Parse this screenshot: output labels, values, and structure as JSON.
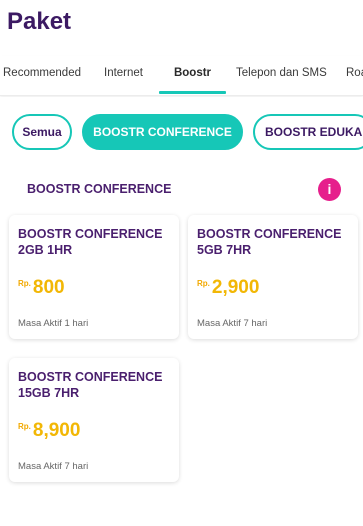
{
  "header": {
    "title": "Paket"
  },
  "tabs": [
    {
      "label": "Recommended"
    },
    {
      "label": "Internet"
    },
    {
      "label": "Boostr"
    },
    {
      "label": "Telepon dan SMS"
    },
    {
      "label": "Roa"
    }
  ],
  "active_tab": "Boostr",
  "filters": [
    {
      "label": "Semua"
    },
    {
      "label": "BOOSTR CONFERENCE"
    },
    {
      "label": "BOOSTR EDUKA"
    }
  ],
  "active_filter": "BOOSTR CONFERENCE",
  "section": {
    "title": "BOOSTR CONFERENCE",
    "info_icon": "i"
  },
  "cards": [
    {
      "name": "BOOSTR CONFERENCE 2GB 1HR",
      "currency": "Rp.",
      "price": "800",
      "period": "Masa Aktif 1 hari"
    },
    {
      "name": "BOOSTR CONFERENCE 5GB 7HR",
      "currency": "Rp.",
      "price": "2,900",
      "period": "Masa Aktif 7 hari"
    },
    {
      "name": "BOOSTR CONFERENCE 15GB 7HR",
      "currency": "Rp.",
      "price": "8,900",
      "period": "Masa Aktif 7 hari"
    }
  ],
  "colors": {
    "accent_teal": "#16c7b7",
    "brand_purple": "#4a1f6e",
    "price_yellow": "#f2b705",
    "info_pink": "#e61f8c"
  }
}
